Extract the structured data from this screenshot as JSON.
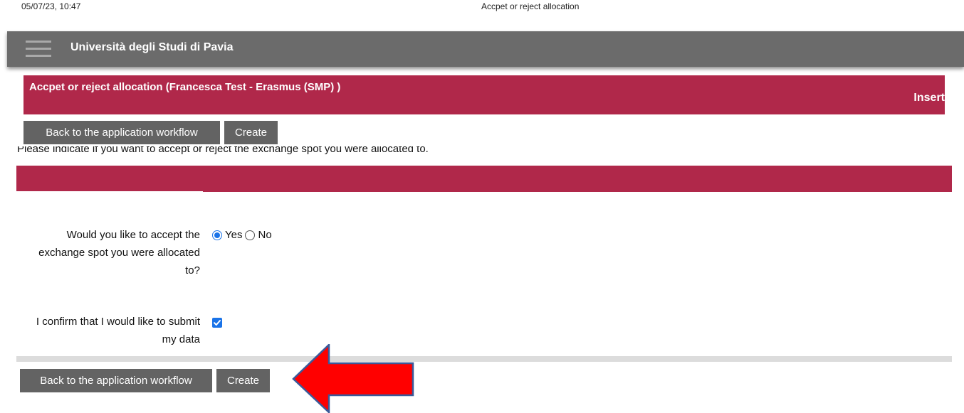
{
  "print_header": {
    "date": "05/07/23, 10:47",
    "title": "Accpet or reject allocation"
  },
  "topbar": {
    "menu_icon": "hamburger-menu-icon",
    "brand": "Università degli Studi di Pavia"
  },
  "page": {
    "title": "Accpet or reject allocation (Francesca Test - Erasmus (SMP) )",
    "mode": "Insert"
  },
  "actions_top": {
    "back_label": "Back to the application workflow",
    "create_label": "Create"
  },
  "instruction": "Please indicate if you want to accept or reject the exchange spot you were allocated to.",
  "form": {
    "accept_question": {
      "label": "Would you like to accept the exchange spot you were allocated to?",
      "options": [
        {
          "label": "Yes",
          "selected": true
        },
        {
          "label": "No",
          "selected": false
        }
      ]
    },
    "confirm": {
      "label": "I confirm that I would like to submit my data",
      "checked": true
    }
  },
  "actions_bottom": {
    "back_label": "Back to the application workflow",
    "create_label": "Create"
  },
  "annotation": {
    "arrow_icon": "red-arrow-left-icon",
    "arrow_color": "#ff0000"
  },
  "colors": {
    "accent": "#b0284a",
    "topbar": "#6b6b6b",
    "button": "#636363",
    "control": "#1a73e8"
  }
}
